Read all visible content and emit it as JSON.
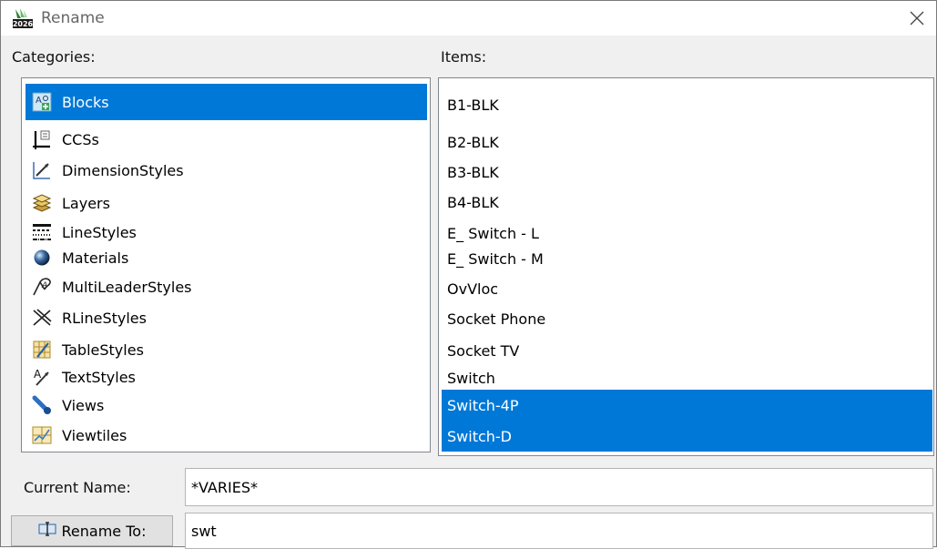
{
  "window": {
    "title": "Rename",
    "close_glyph": "✕"
  },
  "categories": {
    "label": "Categories:",
    "items": [
      {
        "label": "Blocks",
        "icon": "blocks-icon",
        "selected": true
      },
      {
        "label": "CCSs",
        "icon": "ccs-icon",
        "selected": false
      },
      {
        "label": "DimensionStyles",
        "icon": "dimension-styles-icon",
        "selected": false
      },
      {
        "label": "Layers",
        "icon": "layers-icon",
        "selected": false
      },
      {
        "label": "LineStyles",
        "icon": "line-styles-icon",
        "selected": false
      },
      {
        "label": "Materials",
        "icon": "materials-icon",
        "selected": false
      },
      {
        "label": "MultiLeaderStyles",
        "icon": "multileader-styles-icon",
        "selected": false
      },
      {
        "label": "RLineStyles",
        "icon": "rline-styles-icon",
        "selected": false
      },
      {
        "label": "TableStyles",
        "icon": "table-styles-icon",
        "selected": false
      },
      {
        "label": "TextStyles",
        "icon": "text-styles-icon",
        "selected": false
      },
      {
        "label": "Views",
        "icon": "views-icon",
        "selected": false
      },
      {
        "label": "Viewtiles",
        "icon": "viewtiles-icon",
        "selected": false
      }
    ]
  },
  "items": {
    "label": "Items:",
    "rows": [
      {
        "label": "B1-BLK",
        "selected": false
      },
      {
        "label": "B2-BLK",
        "selected": false
      },
      {
        "label": "B3-BLK",
        "selected": false
      },
      {
        "label": "B4-BLK",
        "selected": false
      },
      {
        "label": "E_ Switch - L",
        "selected": false
      },
      {
        "label": "E_ Switch - M",
        "selected": false
      },
      {
        "label": "OvVloc",
        "selected": false
      },
      {
        "label": "Socket Phone",
        "selected": false
      },
      {
        "label": "Socket TV",
        "selected": false
      },
      {
        "label": "Switch",
        "selected": false
      },
      {
        "label": "Switch-4P",
        "selected": true
      },
      {
        "label": "Switch-D",
        "selected": true
      }
    ]
  },
  "current_name": {
    "label": "Current Name:",
    "value": "*VARIES*"
  },
  "rename_to": {
    "button_label": "Rename To:",
    "value": "swt"
  },
  "colors": {
    "selection": "#0078d7",
    "selection_text": "#ffffff"
  }
}
